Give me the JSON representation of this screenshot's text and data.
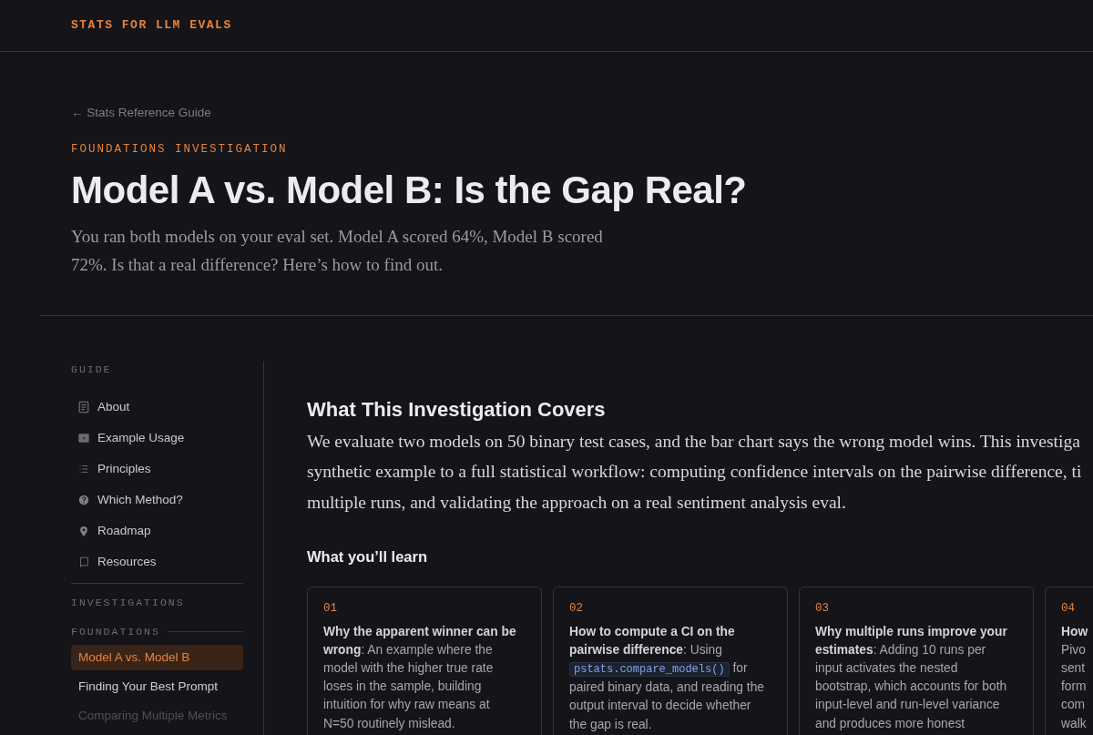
{
  "site": {
    "title": "STATS FOR LLM EVALS"
  },
  "hero": {
    "back_link": "← Stats Reference Guide",
    "kicker": "FOUNDATIONS INVESTIGATION",
    "title": "Model A vs. Model B: Is the Gap Real?",
    "subtitle": "You ran both models on your eval set. Model A scored 64%, Model B scored 72%. Is that a real difference? Here’s how to find out."
  },
  "sidebar": {
    "guide_heading": "GUIDE",
    "guide_items": [
      {
        "label": "About"
      },
      {
        "label": "Example Usage"
      },
      {
        "label": "Principles"
      },
      {
        "label": "Which Method?"
      },
      {
        "label": "Roadmap"
      },
      {
        "label": "Resources"
      }
    ],
    "investigations_heading": "INVESTIGATIONS",
    "group_heading": "FOUNDATIONS",
    "investigation_items": [
      {
        "label": "Model A vs. Model B",
        "selected": true,
        "disabled": false
      },
      {
        "label": "Finding Your Best Prompt",
        "selected": false,
        "disabled": false
      },
      {
        "label": "Comparing Multiple Metrics",
        "selected": false,
        "disabled": true
      }
    ]
  },
  "content": {
    "heading": "What This Investigation Covers",
    "paragraph_lines": [
      "We evaluate two models on 50 binary test cases, and the bar chart says the wrong model wins. This investiga",
      "synthetic example to a full statistical workflow: computing confidence intervals on the pairwise difference, ti",
      "multiple runs, and validating the approach on a real sentiment analysis eval."
    ],
    "learn_heading": "What you’ll learn",
    "cards": [
      {
        "number": "01",
        "lines": [
          {
            "text": "**Why the apparent winner can be**"
          },
          {
            "text": "**wrong**: An example where the"
          },
          {
            "text": "model with the higher true rate"
          },
          {
            "text": "loses in the sample, building"
          },
          {
            "text": "intuition for why raw means at"
          },
          {
            "text": "N=50 routinely mislead."
          }
        ]
      },
      {
        "number": "02",
        "lines": [
          {
            "text": "**How to compute a CI on the**"
          },
          {
            "text": "**pairwise difference**: Using"
          },
          {
            "code": "pstats.compare_models()",
            "text": "for"
          },
          {
            "text": "paired binary data, and reading the"
          },
          {
            "text": "output interval to decide whether"
          },
          {
            "text": "the gap is real."
          }
        ]
      },
      {
        "number": "03",
        "lines": [
          {
            "text": "**Why multiple runs improve your**"
          },
          {
            "text": "**estimates**: Adding 10 runs per"
          },
          {
            "text": "input activates the nested"
          },
          {
            "text": "bootstrap, which accounts for both"
          },
          {
            "text": "input-level and run-level variance"
          },
          {
            "text": "and produces more honest"
          }
        ]
      },
      {
        "number": "04",
        "lines": [
          {
            "text": "**How**"
          },
          {
            "text": "Pivo"
          },
          {
            "text": "sent"
          },
          {
            "text": "form"
          },
          {
            "text": "com"
          },
          {
            "text": "walk"
          }
        ]
      }
    ]
  }
}
